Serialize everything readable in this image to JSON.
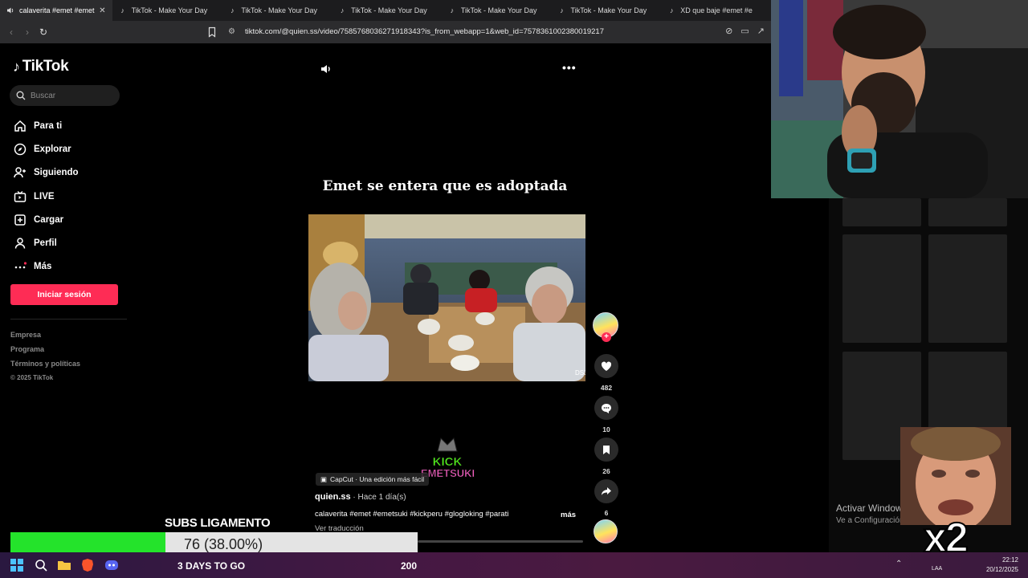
{
  "browser": {
    "tabs": [
      {
        "label": "calaverita #emet #emet",
        "active": true
      },
      {
        "label": "TikTok - Make Your Day"
      },
      {
        "label": "TikTok - Make Your Day"
      },
      {
        "label": "TikTok - Make Your Day"
      },
      {
        "label": "TikTok - Make Your Day"
      },
      {
        "label": "TikTok - Make Your Day"
      },
      {
        "label": "XD que baje #emet #e"
      }
    ],
    "url": "tiktok.com/@quien.ss/video/7585768036271918343?is_from_webapp=1&web_id=7578361002380019217"
  },
  "tiktok": {
    "logo": "TikTok",
    "search_placeholder": "Buscar",
    "nav": [
      {
        "label": "Para ti",
        "icon": "home-icon"
      },
      {
        "label": "Explorar",
        "icon": "compass-icon"
      },
      {
        "label": "Siguiendo",
        "icon": "following-icon"
      },
      {
        "label": "LIVE",
        "icon": "live-icon"
      },
      {
        "label": "Cargar",
        "icon": "upload-icon"
      },
      {
        "label": "Perfil",
        "icon": "profile-icon"
      },
      {
        "label": "Más",
        "icon": "more-icon"
      }
    ],
    "login_button": "Iniciar sesión",
    "footer": [
      "Empresa",
      "Programa",
      "Términos y políticas"
    ],
    "copyright": "© 2025 TikTok",
    "video": {
      "title": "Emet se entera que es adoptada",
      "watermark_top": "KICK",
      "watermark_bottom": "EMETSUKI",
      "capcut": "CapCut · Una edición más fácil",
      "author": "quien.ss",
      "time": " · Hace 1 día(s)",
      "description": "calaverita #emet #emetsuki #kickperu #glogloking #parati",
      "more": "más",
      "translate": "Ver traducción",
      "likes": "482",
      "comments": "10",
      "saves": "26",
      "shares": "6"
    }
  },
  "windows_overlay": {
    "activate": "Activar Windows",
    "activate_sub": "Ve a Configuración para"
  },
  "stream_overlay": {
    "subs_title": "SUBS LIGAMENTO",
    "progress_label": "76 (38.00%)",
    "progress_fraction": 0.38,
    "days_to_go": "3 DAYS TO GO",
    "goal": "200",
    "meme_text": "x2"
  },
  "taskbar": {
    "lang": "LAA",
    "time": "22:12",
    "date": "20/12/2025"
  },
  "colors": {
    "tiktok_red": "#fe2c55",
    "progress_green": "#24e32b"
  }
}
